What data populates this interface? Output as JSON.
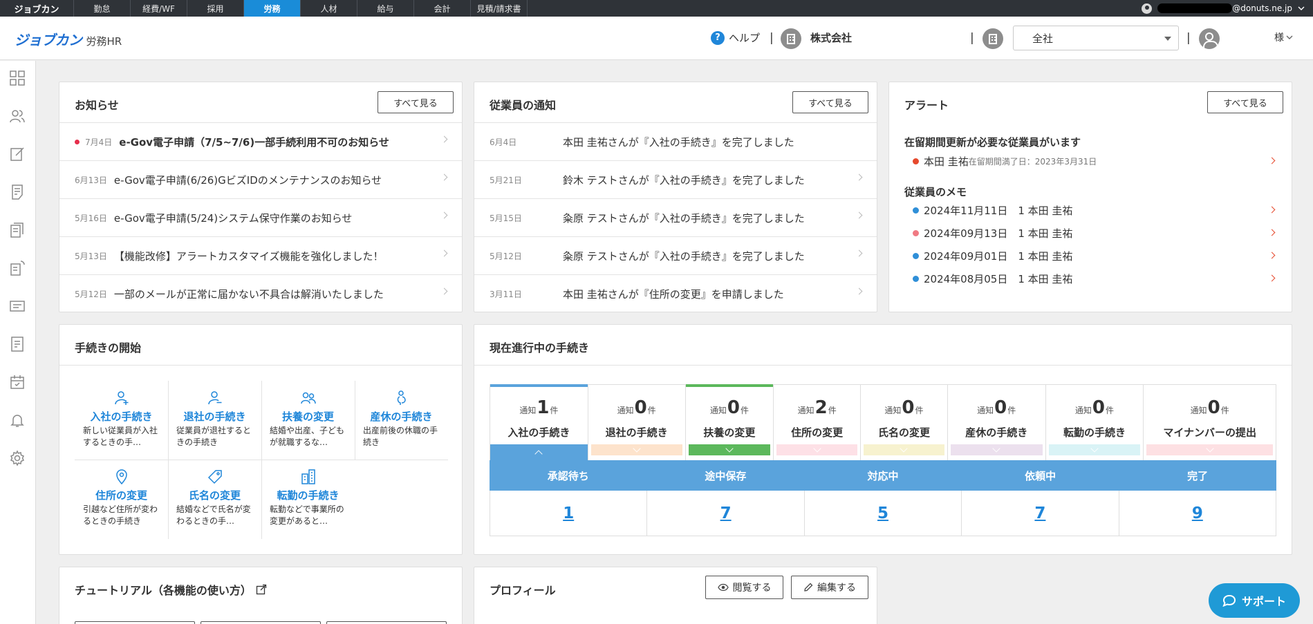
{
  "product_bar": {
    "brand": "ジョブカン",
    "tabs": [
      "勤怠",
      "経費/WF",
      "採用",
      "労務",
      "人材",
      "給与",
      "会計",
      "見積/請求書"
    ],
    "active_tab": "労務",
    "user_email_suffix": "@donuts.ne.jp"
  },
  "header": {
    "logo_mark": "ジョブカン",
    "logo_sub": "労務HR",
    "help_label": "ヘルプ",
    "company_name": "株式会社",
    "office_select": "全社",
    "user_suffix": "様"
  },
  "notices": {
    "title": "お知らせ",
    "view_all": "すべて見る",
    "items": [
      {
        "date": "7月4日",
        "text": "e-Gov電子申請（7/5~7/6)一部手続利用不可のお知らせ",
        "unread": true
      },
      {
        "date": "6月13日",
        "text": "e-Gov電子申請(6/26)GビズIDのメンテナンスのお知らせ",
        "unread": false
      },
      {
        "date": "5月16日",
        "text": "e-Gov電子申請(5/24)システム保守作業のお知らせ",
        "unread": false
      },
      {
        "date": "5月13日",
        "text": "【機能改修】アラートカスタマイズ機能を強化しました！",
        "unread": false
      },
      {
        "date": "5月12日",
        "text": "一部のメールが正常に届かない不具合は解消いたしました",
        "unread": false
      }
    ]
  },
  "employee_notices": {
    "title": "従業員の通知",
    "view_all": "すべて見る",
    "items": [
      {
        "date": "6月4日",
        "text": "本田 圭祐さんが『入社の手続き』を完了しました"
      },
      {
        "date": "5月21日",
        "text": "鈴木 テストさんが『入社の手続き』を完了しました"
      },
      {
        "date": "5月15日",
        "text": "粂原 テストさんが『入社の手続き』を完了しました"
      },
      {
        "date": "5月12日",
        "text": "粂原 テストさんが『入社の手続き』を完了しました"
      },
      {
        "date": "3月11日",
        "text": "本田 圭祐さんが『住所の変更』を申請しました"
      }
    ]
  },
  "alerts": {
    "title": "アラート",
    "view_all": "すべて見る",
    "residence_heading": "在留期間更新が必要な従業員がいます",
    "residence_item": {
      "name": "本田 圭祐",
      "detail": "在留期間満了日：2023年3月31日",
      "color": "#e6492d"
    },
    "memo_heading": "従業員のメモ",
    "memos": [
      {
        "text": "2024年11月11日　1 本田 圭祐",
        "color": "#2f8fd8"
      },
      {
        "text": "2024年09月13日　1 本田 圭祐",
        "color": "#f07a83"
      },
      {
        "text": "2024年09月01日　1 本田 圭祐",
        "color": "#2f8fd8"
      },
      {
        "text": "2024年08月05日　1 本田 圭祐",
        "color": "#2f8fd8"
      }
    ]
  },
  "start_procedures": {
    "title": "手続きの開始",
    "items": [
      {
        "name": "入社の手続き",
        "desc": "新しい従業員が入社するときの手…",
        "icon": "person-add-icon"
      },
      {
        "name": "退社の手続き",
        "desc": "従業員が退社するときの手続き",
        "icon": "person-remove-icon"
      },
      {
        "name": "扶養の変更",
        "desc": "結婚や出産、子どもが就職するな…",
        "icon": "family-icon"
      },
      {
        "name": "産休の手続き",
        "desc": "出産前後の休職の手続き",
        "icon": "maternity-icon"
      },
      {
        "name": "住所の変更",
        "desc": "引越など住所が変わるときの手続き",
        "icon": "location-pin-icon"
      },
      {
        "name": "氏名の変更",
        "desc": "結婚などで氏名が変わるときの手…",
        "icon": "tag-icon"
      },
      {
        "name": "転勤の手続き",
        "desc": "転勤などで事業所の変更があると…",
        "icon": "building-icon"
      }
    ]
  },
  "in_progress": {
    "title": "現在進行中の手続き",
    "notice_prefix": "通知",
    "notice_suffix": "件",
    "tabs": [
      {
        "count": "1",
        "label": "入社の手続き",
        "color": "#5aa3dc",
        "active": true
      },
      {
        "count": "0",
        "label": "退社の手続き",
        "color": "#fde3cc",
        "active": false
      },
      {
        "count": "0",
        "label": "扶養の変更",
        "color": "#5cb85c",
        "active": false
      },
      {
        "count": "2",
        "label": "住所の変更",
        "color": "#fde0e6",
        "active": false
      },
      {
        "count": "0",
        "label": "氏名の変更",
        "color": "#f7f2cf",
        "active": false
      },
      {
        "count": "0",
        "label": "産休の手続き",
        "color": "#ece0ee",
        "active": false
      },
      {
        "count": "0",
        "label": "転勤の手続き",
        "color": "#d9f3f6",
        "active": false
      },
      {
        "count": "0",
        "label": "マイナンバーの提出",
        "color": "#fde0e3",
        "active": false
      }
    ],
    "status_headers": [
      "承認待ち",
      "途中保存",
      "対応中",
      "依頼中",
      "完了"
    ],
    "status_values": [
      "1",
      "7",
      "5",
      "7",
      "9"
    ]
  },
  "tutorial": {
    "title": "チュートリアル（各機能の使い方）"
  },
  "profile": {
    "title": "プロフィール",
    "view_label": "閲覧する",
    "edit_label": "編集する"
  },
  "support": {
    "label": "サポート"
  }
}
